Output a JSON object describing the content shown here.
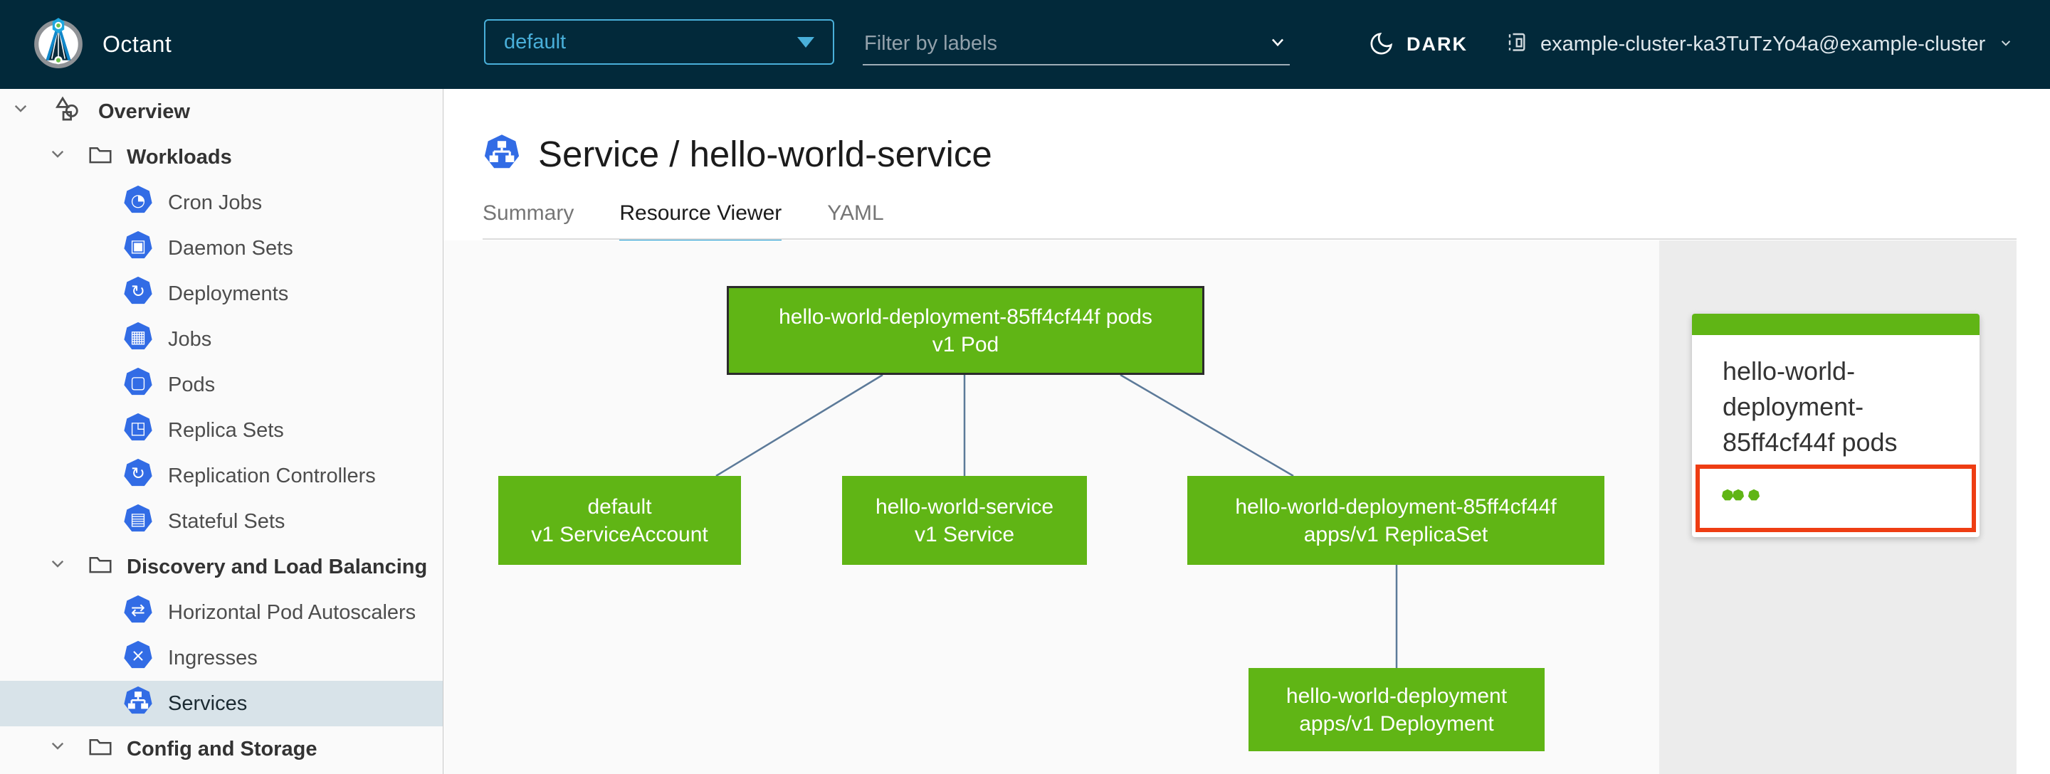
{
  "header": {
    "app_name": "Octant",
    "namespace_selector": {
      "value": "default"
    },
    "label_filter": {
      "placeholder": "Filter by labels"
    },
    "theme_toggle": {
      "label": "DARK",
      "icon": "moon-icon"
    },
    "context": {
      "name": "example-cluster-ka3TuTzYo4a@example-cluster",
      "icon": "cluster-icon"
    }
  },
  "sidebar": {
    "items": [
      {
        "label": "Overview",
        "type": "root",
        "icon": "overview-objects-icon",
        "expanded": true
      },
      {
        "label": "Workloads",
        "type": "group",
        "icon": "folder-icon",
        "expanded": true
      },
      {
        "label": "Cron Jobs",
        "type": "leaf",
        "icon": "cron-jobs-icon",
        "glyph": "◔"
      },
      {
        "label": "Daemon Sets",
        "type": "leaf",
        "icon": "daemon-sets-icon",
        "glyph": "▣"
      },
      {
        "label": "Deployments",
        "type": "leaf",
        "icon": "deployments-icon",
        "glyph": "↻"
      },
      {
        "label": "Jobs",
        "type": "leaf",
        "icon": "jobs-icon",
        "glyph": "▦"
      },
      {
        "label": "Pods",
        "type": "leaf",
        "icon": "pods-icon",
        "glyph": "▢"
      },
      {
        "label": "Replica Sets",
        "type": "leaf",
        "icon": "replica-sets-icon",
        "glyph": "◳"
      },
      {
        "label": "Replication Controllers",
        "type": "leaf",
        "icon": "replication-controllers-icon",
        "glyph": "↻"
      },
      {
        "label": "Stateful Sets",
        "type": "leaf",
        "icon": "stateful-sets-icon",
        "glyph": "▤"
      },
      {
        "label": "Discovery and Load Balancing",
        "type": "group",
        "icon": "folder-icon",
        "expanded": true
      },
      {
        "label": "Horizontal Pod Autoscalers",
        "type": "leaf",
        "icon": "hpa-icon",
        "glyph": "⇄"
      },
      {
        "label": "Ingresses",
        "type": "leaf",
        "icon": "ingresses-icon",
        "glyph": "×"
      },
      {
        "label": "Services",
        "type": "leaf",
        "icon": "services-icon",
        "selected": true
      },
      {
        "label": "Config and Storage",
        "type": "group",
        "icon": "folder-icon",
        "expanded": true
      }
    ]
  },
  "main": {
    "title": "Service / hello-world-service",
    "title_icon": "service-icon",
    "tabs": [
      {
        "label": "Summary",
        "active": false
      },
      {
        "label": "Resource Viewer",
        "active": true
      },
      {
        "label": "YAML",
        "active": false
      }
    ],
    "graph": {
      "nodes": [
        {
          "id": "pod",
          "name": "hello-world-deployment-85ff4cf44f pods",
          "kind": "v1 Pod",
          "status": "ok",
          "selected": true
        },
        {
          "id": "serviceaccount",
          "name": "default",
          "kind": "v1 ServiceAccount",
          "status": "ok"
        },
        {
          "id": "service",
          "name": "hello-world-service",
          "kind": "v1 Service",
          "status": "ok"
        },
        {
          "id": "replicaset",
          "name": "hello-world-deployment-85ff4cf44f",
          "kind": "apps/v1 ReplicaSet",
          "status": "ok"
        },
        {
          "id": "deployment",
          "name": "hello-world-deployment",
          "kind": "apps/v1 Deployment",
          "status": "ok"
        }
      ],
      "edges": [
        {
          "from": "pod",
          "to": "serviceaccount"
        },
        {
          "from": "pod",
          "to": "service"
        },
        {
          "from": "pod",
          "to": "replicaset"
        },
        {
          "from": "replicaset",
          "to": "deployment"
        }
      ]
    }
  },
  "detail_panel": {
    "card": {
      "title": "hello-world-deployment-85ff4cf44f pods",
      "pod_status_dots": 3,
      "highlighted": true
    }
  },
  "colors": {
    "header_bg": "#02293a",
    "accent_blue": "#49afd9",
    "tab_underline_blue": "#179bd3",
    "kubernetes_blue": "#326ce5",
    "node_green": "#60b515",
    "highlight_red": "#ee3d13",
    "selected_row_bg": "#d8e3e9",
    "edge_line": "#5c7a99",
    "panel_bg": "#ececec"
  }
}
